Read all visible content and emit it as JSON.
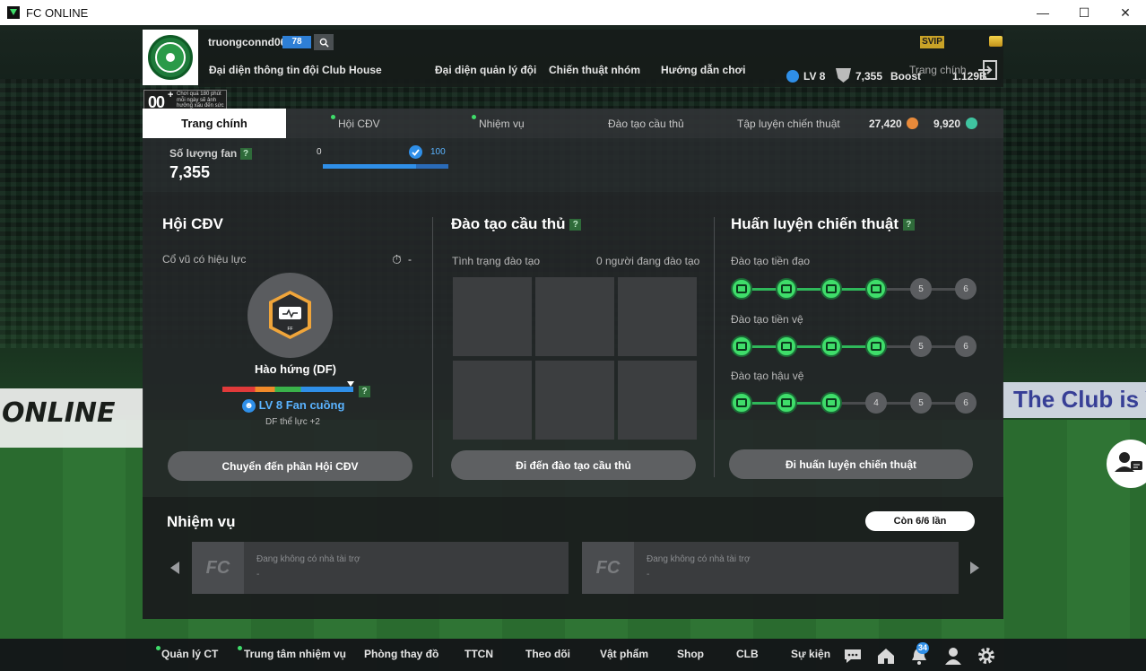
{
  "window": {
    "title": "FC ONLINE",
    "minimize": "—",
    "maximize": "☐",
    "close": "✕"
  },
  "background": {
    "ad_left": "ONLINE",
    "ad_right": "The Club is Y"
  },
  "header": {
    "username": "truongconnd06",
    "ovr": "78",
    "level": "LV 8",
    "fans": "7,355",
    "boost_label": "Boost",
    "svip": "SVIP",
    "coins": "1.129B",
    "nav": [
      "Đại diện thông tin đội",
      "Club House",
      "Đại diện quản lý đội",
      "Chiến thuật nhóm",
      "Hướng dẫn chơi"
    ],
    "home": "Trang chính"
  },
  "promo": {
    "big": "00",
    "sup": "+",
    "text": "Chơi quá 180 phút mỗi ngày sẽ ảnh hưởng xấu đến sức khỏe"
  },
  "tabs": {
    "active": "Trang chính",
    "items": [
      "Hội CĐV",
      "Nhiệm vụ",
      "Đào tạo cầu thủ",
      "Tập luyện chiến thuật"
    ],
    "currency1": "27,420",
    "currency2": "9,920"
  },
  "fan_section": {
    "label": "Số lượng fan",
    "value": "7,355",
    "progress_min": "0",
    "progress_max": "100",
    "progress_fraction": 0.74,
    "help": "?"
  },
  "supporters": {
    "title": "Hội CĐV",
    "effect_label": "Cổ vũ có hiệu lực",
    "timer": "-",
    "cheer_name": "Hào hứng (DF)",
    "fan_level": "LV 8 Fan cuồng",
    "bonus": "DF thể lực +2",
    "button": "Chuyển đến phần Hội CĐV",
    "emblem_small": "FF"
  },
  "training": {
    "title": "Đào tạo cầu thủ",
    "status_label": "Tình trạng đào tạo",
    "count_label": "0 người đang đào tạo",
    "button": "Đi đến đào tạo cầu thủ"
  },
  "tactics": {
    "title": "Huấn luyện chiến thuật",
    "rows": [
      {
        "label": "Đào tạo tiền đạo",
        "active": 4,
        "nodes": [
          "",
          "",
          "",
          "",
          "5",
          "6"
        ]
      },
      {
        "label": "Đào tạo tiền vệ",
        "active": 4,
        "nodes": [
          "",
          "",
          "",
          "",
          "5",
          "6"
        ]
      },
      {
        "label": "Đào tạo hậu vệ",
        "active": 3,
        "nodes": [
          "",
          "",
          "",
          "4",
          "5",
          "6"
        ]
      }
    ],
    "button": "Đi huấn luyện chiến thuật"
  },
  "missions": {
    "title": "Nhiệm vụ",
    "remaining": "Còn 6/6 lần",
    "cards": [
      {
        "logo": "FC",
        "line1": "Đang không có nhà tài trợ",
        "line2": "-"
      },
      {
        "logo": "FC",
        "line1": "Đang không có nhà tài trợ",
        "line2": "-"
      }
    ]
  },
  "bottom_nav": {
    "items": [
      "Quản lý CT",
      "Trung tâm nhiệm vụ",
      "Phòng thay đồ",
      "TTCN",
      "Theo dõi",
      "Vật phẩm",
      "Shop",
      "CLB",
      "Sự kiện"
    ],
    "notification_count": "34"
  },
  "colors": {
    "accent_green": "#3fdd6a",
    "accent_blue": "#2f8fe8",
    "panel": "#242628"
  }
}
